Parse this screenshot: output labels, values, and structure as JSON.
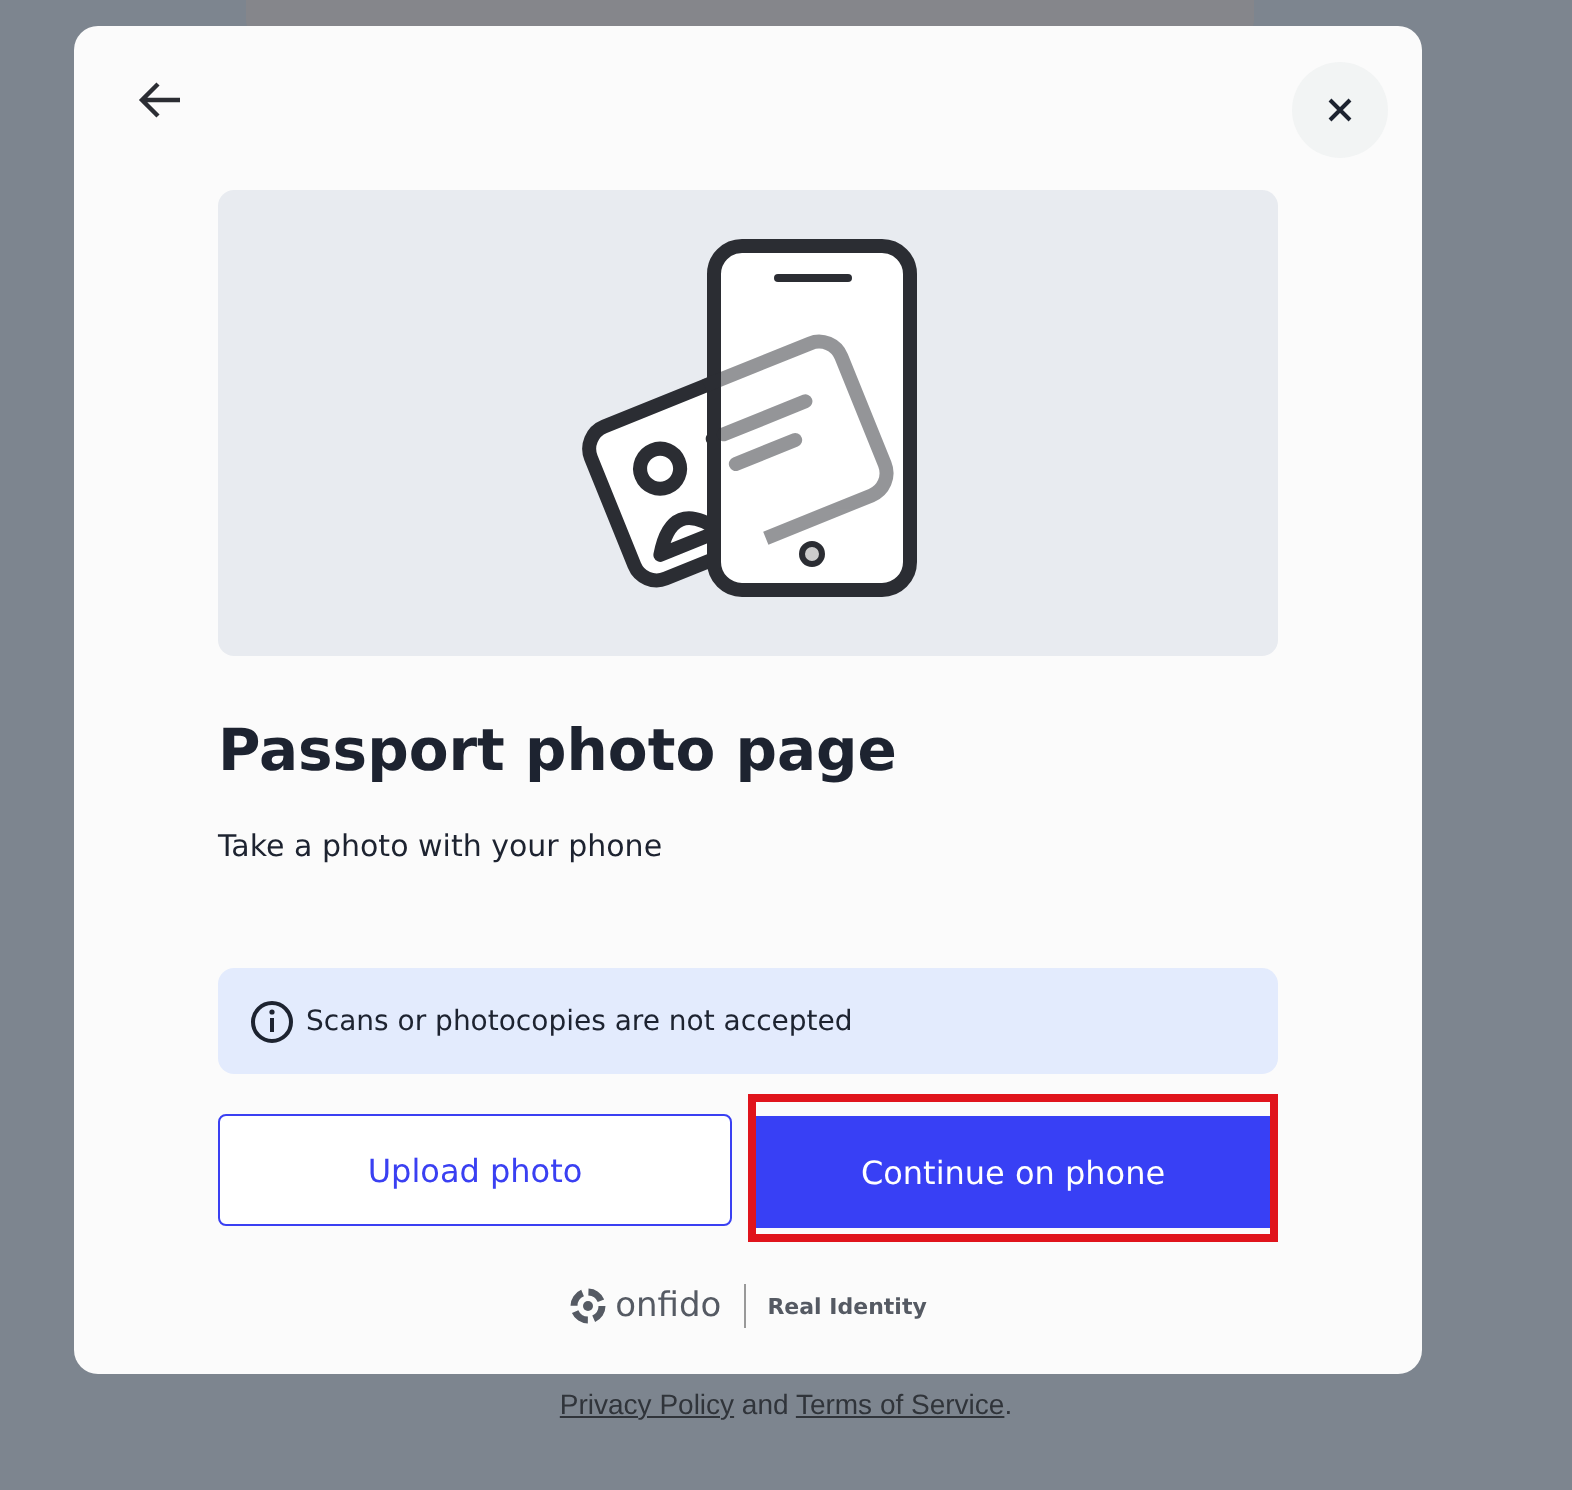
{
  "modal": {
    "title": "Passport photo page",
    "subtitle": "Take a photo with your phone",
    "notice": "Scans or photocopies are not accepted",
    "buttons": [
      {
        "kind": "secondary",
        "label": "Upload photo",
        "highlighted": false
      },
      {
        "kind": "primary",
        "label": "Continue on phone",
        "highlighted": true
      }
    ],
    "brand": {
      "name": "onfido",
      "tagline": "Real Identity"
    }
  },
  "background_footer": [
    {
      "kind": "link",
      "text": "Privacy Policy"
    },
    {
      "kind": "text",
      "text": " and "
    },
    {
      "kind": "link",
      "text": "Terms of Service"
    },
    {
      "kind": "text",
      "text": "."
    }
  ]
}
